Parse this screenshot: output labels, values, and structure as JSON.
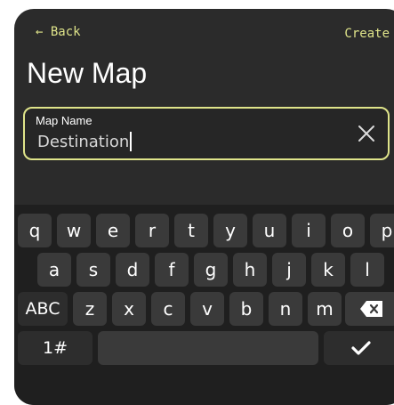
{
  "header": {
    "back_label": "← Back",
    "create_label": "Create",
    "title": "New Map"
  },
  "map_name_field": {
    "label": "Map Name",
    "value": "Destination"
  },
  "keyboard": {
    "row1": [
      "q",
      "w",
      "e",
      "r",
      "t",
      "y",
      "u",
      "i",
      "o",
      "p"
    ],
    "row2": [
      "a",
      "s",
      "d",
      "f",
      "g",
      "h",
      "j",
      "k",
      "l"
    ],
    "row3_letters": [
      "z",
      "x",
      "c",
      "v",
      "b",
      "n",
      "m"
    ],
    "abc_label": "ABC",
    "numbers_label": "1#"
  },
  "icons": {
    "clear": "close-icon",
    "backspace": "backspace-icon",
    "done": "checkmark-icon"
  },
  "colors": {
    "accent": "#dfe48a",
    "background": "#2b2b2b",
    "keyboard_bg": "#1f1f1f",
    "key": "#3a3a3a"
  }
}
